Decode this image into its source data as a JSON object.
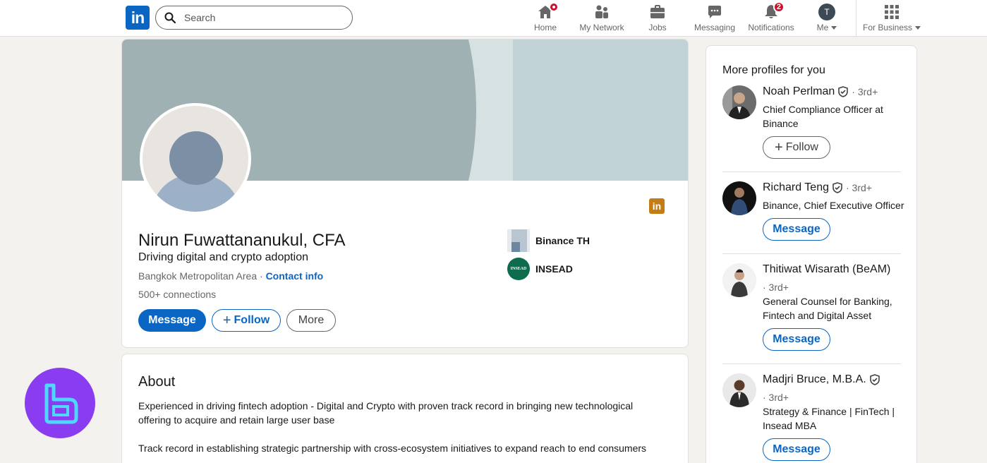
{
  "nav": {
    "logo": "in",
    "search_placeholder": "Search",
    "items": [
      {
        "label": "Home",
        "icon": "home-icon"
      },
      {
        "label": "My Network",
        "icon": "network-icon"
      },
      {
        "label": "Jobs",
        "icon": "jobs-icon"
      },
      {
        "label": "Messaging",
        "icon": "messaging-icon"
      },
      {
        "label": "Notifications",
        "icon": "bell-icon",
        "badge": "2"
      },
      {
        "label": "Me",
        "icon": "avatar",
        "initial": "T"
      },
      {
        "label": "For Business",
        "icon": "grid-icon"
      }
    ]
  },
  "profile": {
    "name": "Nirun Fuwattananukul, CFA",
    "headline": "Driving digital and crypto adoption",
    "location": "Bangkok Metropolitan Area",
    "separator": " · ",
    "contact_label": "Contact info",
    "connections": "500+ connections",
    "buttons": {
      "message": "Message",
      "follow": "Follow",
      "more": "More"
    },
    "orgs": [
      {
        "name": "Binance TH"
      },
      {
        "name": "INSEAD",
        "logo_text": "INSEAD"
      }
    ],
    "linkedin_badge": "in"
  },
  "about": {
    "title": "About",
    "paragraphs": [
      "Experienced in driving fintech adoption - Digital and Crypto with proven track record in bringing new technological offering to acquire and retain large user base",
      "Track record in establishing strategic partnership with cross-ecosystem initiatives to expand reach to end consumers"
    ]
  },
  "sidebar": {
    "title": "More profiles for you",
    "people": [
      {
        "name": "Noah Perlman",
        "degree": "· 3rd+",
        "desc": "Chief Compliance Officer at Binance",
        "button": "Follow"
      },
      {
        "name": "Richard Teng",
        "degree": "· 3rd+",
        "desc": "Binance, Chief Executive Officer",
        "button": "Message"
      },
      {
        "name": "Thitiwat Wisarath (BeAM)",
        "degree": "· 3rd+",
        "desc": "General Counsel for Banking, Fintech and Digital Asset",
        "button": "Message"
      },
      {
        "name": "Madjri Bruce, M.B.A.",
        "degree": "· 3rd+",
        "desc": "Strategy & Finance | FinTech | Insead MBA",
        "button": "Message"
      }
    ]
  },
  "colors": {
    "brand": "#0a66c2",
    "badge": "#cb112d",
    "watermark": "#8a3cf0"
  }
}
